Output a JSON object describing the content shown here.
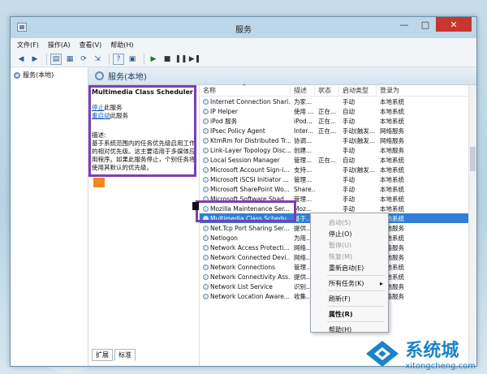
{
  "window": {
    "title": "服务",
    "minimize": "—",
    "maximize": "□",
    "close": "✕"
  },
  "menu": [
    "文件(F)",
    "操作(A)",
    "查看(V)",
    "帮助(H)"
  ],
  "tree": {
    "root": "服务(本地)"
  },
  "header": {
    "title": "服务(本地)"
  },
  "description": {
    "service_name": "Multimedia Class Scheduler",
    "stop_link": "停止",
    "stop_suffix": "此服务",
    "restart_link": "重启动",
    "restart_suffix": "此服务",
    "label": "描述:",
    "text": "基于系统范围内的任务优先级启用工作的相对优先级。这主要适用于多媒体应用程序。如果此服务停止，个别任务将使用其默认的优先级。"
  },
  "columns": {
    "name": "名称",
    "desc": "描述",
    "status": "状态",
    "startup": "启动类型",
    "logon": "登录为"
  },
  "rows": [
    {
      "name": "Internet Connection Shari...",
      "desc": "为家...",
      "status": "",
      "startup": "手动",
      "logon": "本地系统"
    },
    {
      "name": "IP Helper",
      "desc": "使用 ...",
      "status": "正在...",
      "startup": "自动",
      "logon": "本地系统"
    },
    {
      "name": "iPod 服务",
      "desc": "iPod...",
      "status": "正在...",
      "startup": "手动",
      "logon": "本地系统"
    },
    {
      "name": "IPsec Policy Agent",
      "desc": "Inter...",
      "status": "正在...",
      "startup": "手动(触发...",
      "logon": "网络服务"
    },
    {
      "name": "KtmRm for Distributed Tr...",
      "desc": "协调...",
      "status": "",
      "startup": "手动(触发...",
      "logon": "网络服务"
    },
    {
      "name": "Link-Layer Topology Disc...",
      "desc": "创建...",
      "status": "",
      "startup": "手动",
      "logon": "本地服务"
    },
    {
      "name": "Local Session Manager",
      "desc": "管理...",
      "status": "正在...",
      "startup": "自动",
      "logon": "本地系统"
    },
    {
      "name": "Microsoft Account Sign-i...",
      "desc": "支持...",
      "status": "",
      "startup": "手动(触发...",
      "logon": "本地系统"
    },
    {
      "name": "Microsoft iSCSI Initiator ...",
      "desc": "管理...",
      "status": "",
      "startup": "手动",
      "logon": "本地系统"
    },
    {
      "name": "Microsoft SharePoint Wo...",
      "desc": "Share...",
      "status": "",
      "startup": "手动",
      "logon": "本地系统"
    },
    {
      "name": "Microsoft Software Shad...",
      "desc": "管理...",
      "status": "",
      "startup": "手动",
      "logon": "本地系统"
    },
    {
      "name": "Mozilla Maintenance Ser...",
      "desc": "Moz...",
      "status": "",
      "startup": "手动",
      "logon": "本地系统"
    },
    {
      "name": "Multimedia Class Schedu...",
      "desc": "基于...",
      "status": "",
      "startup": "",
      "logon": "本地系统"
    },
    {
      "name": "Net.Tcp Port Sharing Ser...",
      "desc": "提供...",
      "status": "",
      "startup": "",
      "logon": "本地服务"
    },
    {
      "name": "Netlogon",
      "desc": "为用...",
      "status": "",
      "startup": "",
      "logon": "本地系统"
    },
    {
      "name": "Network Access Protecti...",
      "desc": "网络...",
      "status": "",
      "startup": "",
      "logon": "网络服务"
    },
    {
      "name": "Network Connected Devi...",
      "desc": "网络...",
      "status": "",
      "startup": "",
      "logon": "本地服务"
    },
    {
      "name": "Network Connections",
      "desc": "管理...",
      "status": "",
      "startup": "",
      "logon": "本地系统"
    },
    {
      "name": "Network Connectivity Ass...",
      "desc": "提供...",
      "status": "",
      "startup": "",
      "logon": "本地系统"
    },
    {
      "name": "Network List Service",
      "desc": "识别...",
      "status": "",
      "startup": "",
      "logon": "本地服务"
    },
    {
      "name": "Network Location Aware...",
      "desc": "收集...",
      "status": "",
      "startup": "",
      "logon": "网络服务"
    }
  ],
  "tabs": [
    "扩展",
    "标准"
  ],
  "context_menu": {
    "start": "启动(S)",
    "stop": "停止(O)",
    "pause": "暂停(U)",
    "resume": "恢复(M)",
    "restart": "重新启动(E)",
    "all_tasks": "所有任务(K)",
    "all_tasks_arrow": "▸",
    "refresh": "刷新(F)",
    "properties": "属性(R)",
    "help": "帮助(H)"
  },
  "watermark": {
    "main": "系统城",
    "sub": "xitongcheng.com"
  },
  "colors": {
    "selection": "#2f7fd8",
    "highlight_box": "#7c3fb3",
    "close_button": "#c7372f"
  }
}
